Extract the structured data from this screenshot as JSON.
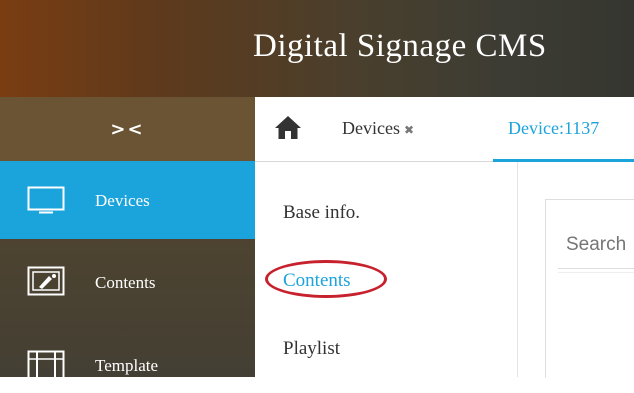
{
  "header": {
    "title": "Digital Signage CMS"
  },
  "sidebar": {
    "toggle_label": "><",
    "items": [
      {
        "label": "Devices",
        "icon": "monitor-icon",
        "active": true
      },
      {
        "label": "Contents",
        "icon": "image-icon",
        "active": false
      },
      {
        "label": "Template",
        "icon": "template-icon",
        "active": false
      }
    ]
  },
  "tabs": {
    "home_icon": "home-icon",
    "devices": {
      "label": "Devices",
      "close": "✖"
    },
    "device": {
      "label": "Device:1137"
    }
  },
  "submenu": {
    "items": [
      {
        "label": "Base info."
      },
      {
        "label": "Contents",
        "active": true
      },
      {
        "label": "Playlist"
      }
    ]
  },
  "panel": {
    "search_placeholder": "Search"
  },
  "colors": {
    "accent": "#1ba3db",
    "annotation": "#c8212e",
    "header_start": "#7a3d12",
    "header_end": "#35362f"
  }
}
